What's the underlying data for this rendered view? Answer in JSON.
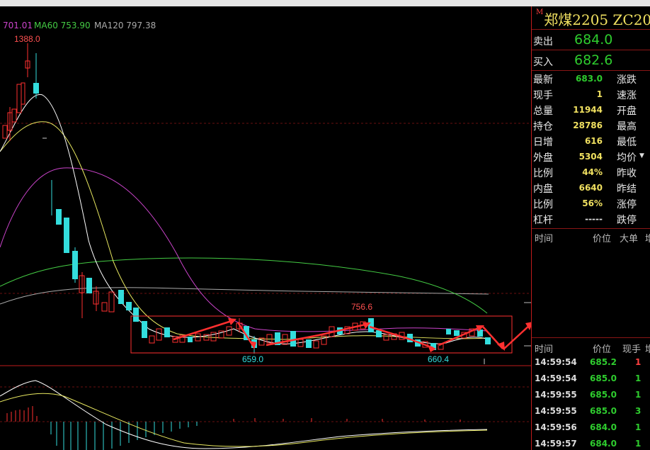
{
  "window": {
    "title": "郑煤2205  ZC20"
  },
  "ma_labels": [
    {
      "text": "701.01",
      "color": "#cc44cc"
    },
    {
      "text": "MA60 753.90",
      "color": "#44cc44"
    },
    {
      "text": "MA120 797.38",
      "color": "#aaaaaa"
    }
  ],
  "annotations": {
    "high": "1388.0",
    "low1": "659.0",
    "peak": "756.6",
    "low2": "660.4"
  },
  "quote": {
    "sell_label": "卖出",
    "sell_price": "684.0",
    "buy_label": "买入",
    "buy_price": "682.6",
    "rows": [
      {
        "label": "最新",
        "value": "683.0",
        "color": "#2ecc2e",
        "right": "涨跌"
      },
      {
        "label": "现手",
        "value": "1",
        "color": "#f0e060",
        "right": "速涨"
      },
      {
        "label": "总量",
        "value": "11944",
        "color": "#f0e060",
        "right": "开盘"
      },
      {
        "label": "持仓",
        "value": "28786",
        "color": "#f0e060",
        "right": "最高"
      },
      {
        "label": "日增",
        "value": "616",
        "color": "#f0e060",
        "right": "最低"
      },
      {
        "label": "外盘",
        "value": "5304",
        "color": "#f0e060",
        "right": "均价"
      },
      {
        "label": "比例",
        "value": "44%",
        "color": "#f0e060",
        "right": "昨收"
      },
      {
        "label": "内盘",
        "value": "6640",
        "color": "#f0e060",
        "right": "昨结"
      },
      {
        "label": "比例",
        "value": "56%",
        "color": "#f0e060",
        "right": "涨停"
      },
      {
        "label": "杠杆",
        "value": "-----",
        "color": "#dddddd",
        "right": "跌停"
      }
    ]
  },
  "tick_header": {
    "time": "时间",
    "price": "价位",
    "big": "大单",
    "extra": "增"
  },
  "trades_header": {
    "time": "时间",
    "price": "价位",
    "vol": "现手",
    "extra": "增"
  },
  "trades": [
    {
      "time": "14:59:54",
      "price": "685.2",
      "vol": "1",
      "vol_color": "#ff4040"
    },
    {
      "time": "14:59:54",
      "price": "685.0",
      "vol": "1",
      "vol_color": "#2ecc2e"
    },
    {
      "time": "14:59:55",
      "price": "685.0",
      "vol": "1",
      "vol_color": "#2ecc2e"
    },
    {
      "time": "14:59:55",
      "price": "685.0",
      "vol": "3",
      "vol_color": "#2ecc2e"
    },
    {
      "time": "14:59:56",
      "price": "684.0",
      "vol": "1",
      "vol_color": "#2ecc2e"
    },
    {
      "time": "14:59:57",
      "price": "684.0",
      "vol": "1",
      "vol_color": "#2ecc2e"
    }
  ],
  "colors": {
    "up": "#ff3030",
    "down": "#33dddd",
    "ma5": "#ffffff",
    "ma10": "#e8e860",
    "ma20": "#cc44cc",
    "ma60": "#44cc44",
    "ma120": "#aaaaaa",
    "border": "#c01c1c"
  }
}
